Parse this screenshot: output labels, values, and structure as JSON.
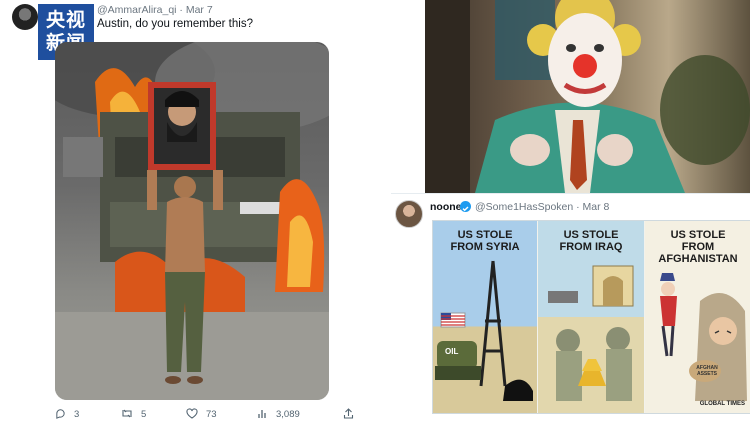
{
  "left_tweet": {
    "handle": "@AmmarAlira_qi · Mar 7",
    "text": "Austin, do you remember this?",
    "logo_text": [
      "央视",
      "新闻"
    ],
    "actions": {
      "replies": "3",
      "retweets": "5",
      "likes": "73",
      "views": "3,089"
    }
  },
  "right_tweet": {
    "author": "noone",
    "handle": "@Some1HasSpoken · Mar 8",
    "cartoon": {
      "panels": [
        {
          "caption_line1": "US STOLE",
          "caption_line2": "FROM SYRIA",
          "label": "OIL"
        },
        {
          "caption_line1": "US STOLE",
          "caption_line2": "FROM IRAQ"
        },
        {
          "caption_line1": "US STOLE",
          "caption_line2": "FROM AFGHANISTAN",
          "label": "AFGHAN ASSETS"
        }
      ],
      "signature": "GLOBAL TIMES"
    }
  },
  "icons": [
    "reply-icon",
    "retweet-icon",
    "like-icon",
    "views-icon",
    "share-icon",
    "verified-icon"
  ],
  "colors": {
    "accent_blue": "#1d9bf0",
    "text_primary": "#0f1419",
    "text_secondary": "#536471",
    "logo_blue": "#1f4f9e"
  }
}
